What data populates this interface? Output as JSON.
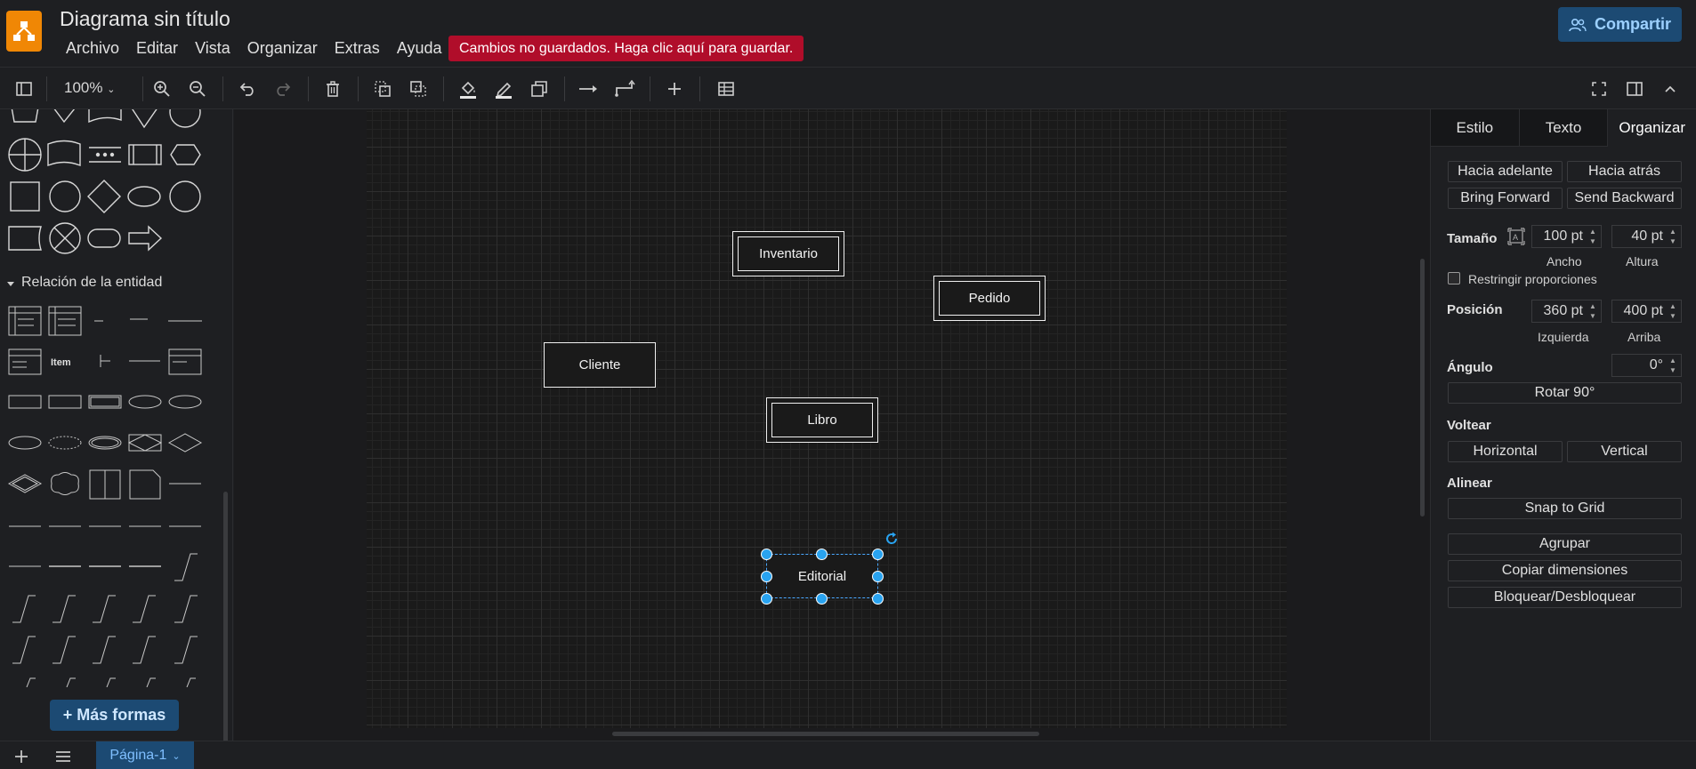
{
  "header": {
    "title": "Diagrama sin título",
    "menu": [
      "Archivo",
      "Editar",
      "Vista",
      "Organizar",
      "Extras",
      "Ayuda"
    ],
    "unsaved_notice": "Cambios no guardados. Haga clic aquí para guardar.",
    "share_label": "Compartir"
  },
  "toolbar": {
    "zoom": "100%"
  },
  "sidebar": {
    "section_title": "Relación de la entidad",
    "item_label": "Item",
    "more_shapes": "+ Más formas"
  },
  "canvas": {
    "entities": [
      {
        "label": "Inventario",
        "weak": true
      },
      {
        "label": "Pedido",
        "weak": true
      },
      {
        "label": "Cliente",
        "weak": false
      },
      {
        "label": "Libro",
        "weak": true
      },
      {
        "label": "Editorial",
        "weak": false,
        "selected": true
      }
    ]
  },
  "panel": {
    "tabs": [
      "Estilo",
      "Texto",
      "Organizar"
    ],
    "active_tab": "Organizar",
    "to_front": "Hacia adelante",
    "to_back": "Hacia atrás",
    "bring_forward": "Bring Forward",
    "send_backward": "Send Backward",
    "size_label": "Tamaño",
    "width_value": "100 pt",
    "height_value": "40 pt",
    "width_label": "Ancho",
    "height_label": "Altura",
    "constrain_label": "Restringir proporciones",
    "position_label": "Posición",
    "left_value": "360 pt",
    "top_value": "400 pt",
    "left_label": "Izquierda",
    "top_label": "Arriba",
    "angle_label": "Ángulo",
    "angle_value": "0°",
    "rotate_label": "Rotar 90°",
    "flip_label": "Voltear",
    "flip_h": "Horizontal",
    "flip_v": "Vertical",
    "align_label": "Alinear",
    "snap_label": "Snap to Grid",
    "group_label": "Agrupar",
    "copy_size_label": "Copiar dimensiones",
    "lock_label": "Bloquear/Desbloquear"
  },
  "footer": {
    "page_tab": "Página-1"
  },
  "colors": {
    "accent": "#1c4a73",
    "selection": "#29a3f0",
    "unsaved": "#b00d2a",
    "logo": "#f08705"
  }
}
